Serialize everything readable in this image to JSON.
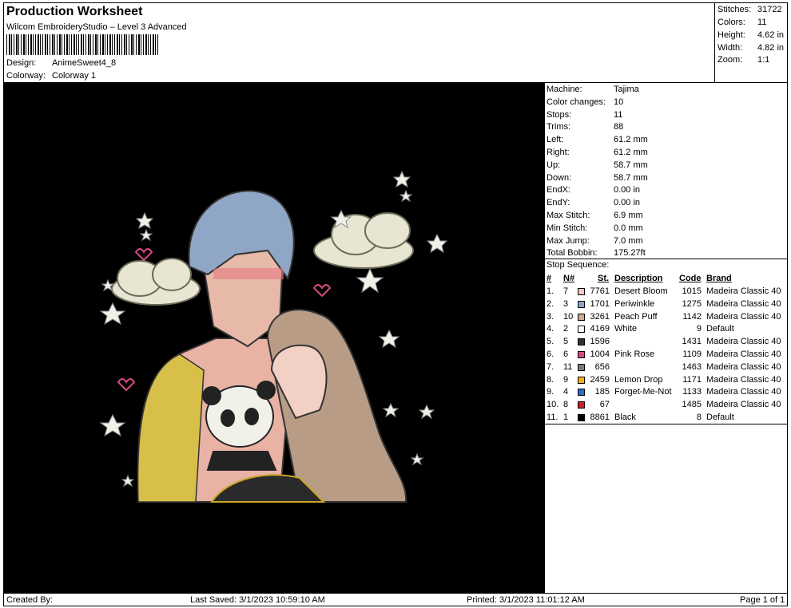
{
  "header": {
    "title": "Production Worksheet",
    "software": "Wilcom EmbroideryStudio – Level 3 Advanced",
    "design_label": "Design:",
    "design_value": "AnimeSweet4_8",
    "colorway_label": "Colorway:",
    "colorway_value": "Colorway 1"
  },
  "summary": {
    "stitches_label": "Stitches:",
    "stitches": "31722",
    "colors_label": "Colors:",
    "colors": "11",
    "height_label": "Height:",
    "height": "4.62 in",
    "width_label": "Width:",
    "width": "4.82 in",
    "zoom_label": "Zoom:",
    "zoom": "1:1"
  },
  "machine_info": [
    {
      "label": "Machine:",
      "value": "Tajima"
    },
    {
      "label": "Color changes:",
      "value": "10"
    },
    {
      "label": "Stops:",
      "value": "11"
    },
    {
      "label": "Trims:",
      "value": "88"
    },
    {
      "label": "Left:",
      "value": "61.2 mm"
    },
    {
      "label": "Right:",
      "value": "61.2 mm"
    },
    {
      "label": "Up:",
      "value": "58.7 mm"
    },
    {
      "label": "Down:",
      "value": "58.7 mm"
    },
    {
      "label": "EndX:",
      "value": "0.00 in"
    },
    {
      "label": "EndY:",
      "value": "0.00 in"
    },
    {
      "label": "Max Stitch:",
      "value": "6.9 mm"
    },
    {
      "label": "Min Stitch:",
      "value": "0.0 mm"
    },
    {
      "label": "Max Jump:",
      "value": "7.0 mm"
    },
    {
      "label": "Total Bobbin:",
      "value": "175.27ft"
    }
  ],
  "stop_sequence": {
    "title": "Stop Sequence:",
    "headers": {
      "index": "#",
      "needle": "N#",
      "st": "St.",
      "description": "Description",
      "code": "Code",
      "brand": "Brand"
    },
    "rows": [
      {
        "index": "1.",
        "needle": "7",
        "color": "#f5c8c3",
        "st": "7761",
        "description": "Desert Bloom",
        "code": "1015",
        "brand": "Madeira Classic 40"
      },
      {
        "index": "2.",
        "needle": "3",
        "color": "#8aa4c8",
        "st": "1701",
        "description": "Periwinkle",
        "code": "1275",
        "brand": "Madeira Classic 40"
      },
      {
        "index": "3.",
        "needle": "10",
        "color": "#c9a995",
        "st": "3261",
        "description": "Peach Puff",
        "code": "1142",
        "brand": "Madeira Classic 40"
      },
      {
        "index": "4.",
        "needle": "2",
        "color": "#ffffff",
        "st": "4169",
        "description": "White",
        "code": "9",
        "brand": "Default"
      },
      {
        "index": "5.",
        "needle": "5",
        "color": "#333333",
        "st": "1596",
        "description": "",
        "code": "1431",
        "brand": "Madeira Classic 40"
      },
      {
        "index": "6.",
        "needle": "6",
        "color": "#d94a86",
        "st": "1004",
        "description": "Pink Rose",
        "code": "1109",
        "brand": "Madeira Classic 40"
      },
      {
        "index": "7.",
        "needle": "11",
        "color": "#7a7a72",
        "st": "656",
        "description": "",
        "code": "1463",
        "brand": "Madeira Classic 40"
      },
      {
        "index": "8.",
        "needle": "9",
        "color": "#f2b318",
        "st": "2459",
        "description": "Lemon Drop",
        "code": "1171",
        "brand": "Madeira Classic 40"
      },
      {
        "index": "9.",
        "needle": "4",
        "color": "#2f6fc0",
        "st": "185",
        "description": "Forget-Me-Not",
        "code": "1133",
        "brand": "Madeira Classic 40"
      },
      {
        "index": "10.",
        "needle": "8",
        "color": "#c8202b",
        "st": "67",
        "description": "",
        "code": "1485",
        "brand": "Madeira Classic 40"
      },
      {
        "index": "11.",
        "needle": "1",
        "color": "#000000",
        "st": "8861",
        "description": "Black",
        "code": "8",
        "brand": "Default"
      }
    ]
  },
  "footer": {
    "created_by": "Created By:",
    "last_saved": "Last Saved: 3/1/2023 10:59:10 AM",
    "printed": "Printed: 3/1/2023 11:01:12 AM",
    "page": "Page 1 of 1"
  }
}
